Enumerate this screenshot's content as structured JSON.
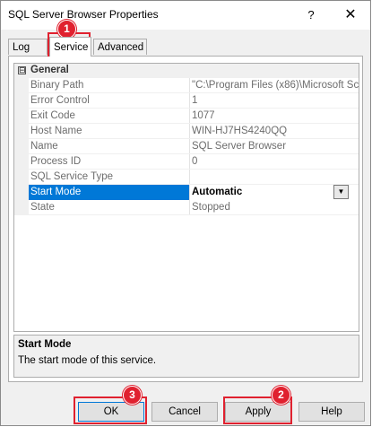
{
  "window": {
    "title": "SQL Server Browser Properties",
    "help_glyph": "?",
    "close_glyph": "✕"
  },
  "tabs": [
    {
      "label": "Log On",
      "active": false
    },
    {
      "label": "Service",
      "active": true
    },
    {
      "label": "Advanced",
      "active": false
    }
  ],
  "grid": {
    "category": {
      "expander": "⊟",
      "label": "General"
    },
    "rows": [
      {
        "name": "Binary Path",
        "value": "\"C:\\Program Files (x86)\\Microsoft Sc"
      },
      {
        "name": "Error Control",
        "value": "1"
      },
      {
        "name": "Exit Code",
        "value": "1077"
      },
      {
        "name": "Host Name",
        "value": "WIN-HJ7HS4240QQ"
      },
      {
        "name": "Name",
        "value": "SQL Server Browser"
      },
      {
        "name": "Process ID",
        "value": "0"
      },
      {
        "name": "SQL Service Type",
        "value": ""
      },
      {
        "name": "Start Mode",
        "value": "Automatic",
        "selected": true
      },
      {
        "name": "State",
        "value": "Stopped"
      }
    ],
    "dropdown_glyph": "▼"
  },
  "description": {
    "title": "Start Mode",
    "text": "The start mode of this service."
  },
  "buttons": {
    "ok": "OK",
    "cancel": "Cancel",
    "apply": "Apply",
    "help": "Help"
  },
  "annotations": [
    "1",
    "2",
    "3"
  ],
  "colors": {
    "selection": "#0078d7",
    "annotation": "#e0212f"
  }
}
